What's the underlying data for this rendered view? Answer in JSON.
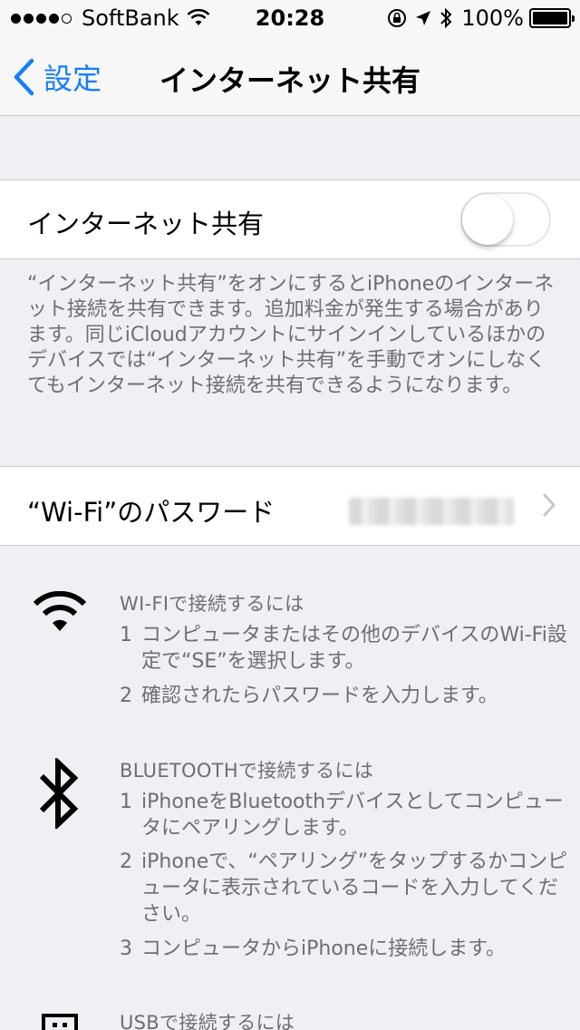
{
  "status_bar": {
    "carrier": "SoftBank",
    "time": "20:28",
    "battery": "100%",
    "battery_level": 1.0
  },
  "nav": {
    "back_label": "設定",
    "title": "インターネット共有"
  },
  "hotspot_cell": {
    "label": "インターネット共有",
    "toggle_on": false
  },
  "hotspot_note": "“インターネット共有”をオンにするとiPhoneのインターネット接続を共有できます。追加料金が発生する場合があります。同じiCloudアカウントにサインインしているほかのデバイスでは“インターネット共有”を手動でオンにしなくてもインターネット接続を共有できるようになります。",
  "wifi_password_cell": {
    "label": "“Wi-Fi”のパスワード"
  },
  "instructions": {
    "wifi": {
      "icon": "wifi-icon",
      "title": "WI-FIで接続するには",
      "steps": [
        {
          "num": "1",
          "text": "コンピュータまたはその他のデバイスのWi-Fi設定で“SE”を選択します。"
        },
        {
          "num": "2",
          "text": "確認されたらパスワードを入力します。"
        }
      ]
    },
    "bluetooth": {
      "icon": "bluetooth-icon",
      "title": "BLUETOOTHで接続するには",
      "steps": [
        {
          "num": "1",
          "text": "iPhoneをBluetoothデバイスとしてコンピュータにペアリングします。"
        },
        {
          "num": "2",
          "text": "iPhoneで、“ペアリング”をタップするかコンピュータに表示されているコードを入力してください。"
        },
        {
          "num": "3",
          "text": "コンピュータからiPhoneに接続します。"
        }
      ]
    },
    "usb": {
      "icon": "usb-icon",
      "title": "USBで接続するには"
    }
  },
  "colors": {
    "accent": "#157efb",
    "background": "#efeff4",
    "secondary_text": "#6d6d72",
    "separator": "#c8c7cc"
  }
}
